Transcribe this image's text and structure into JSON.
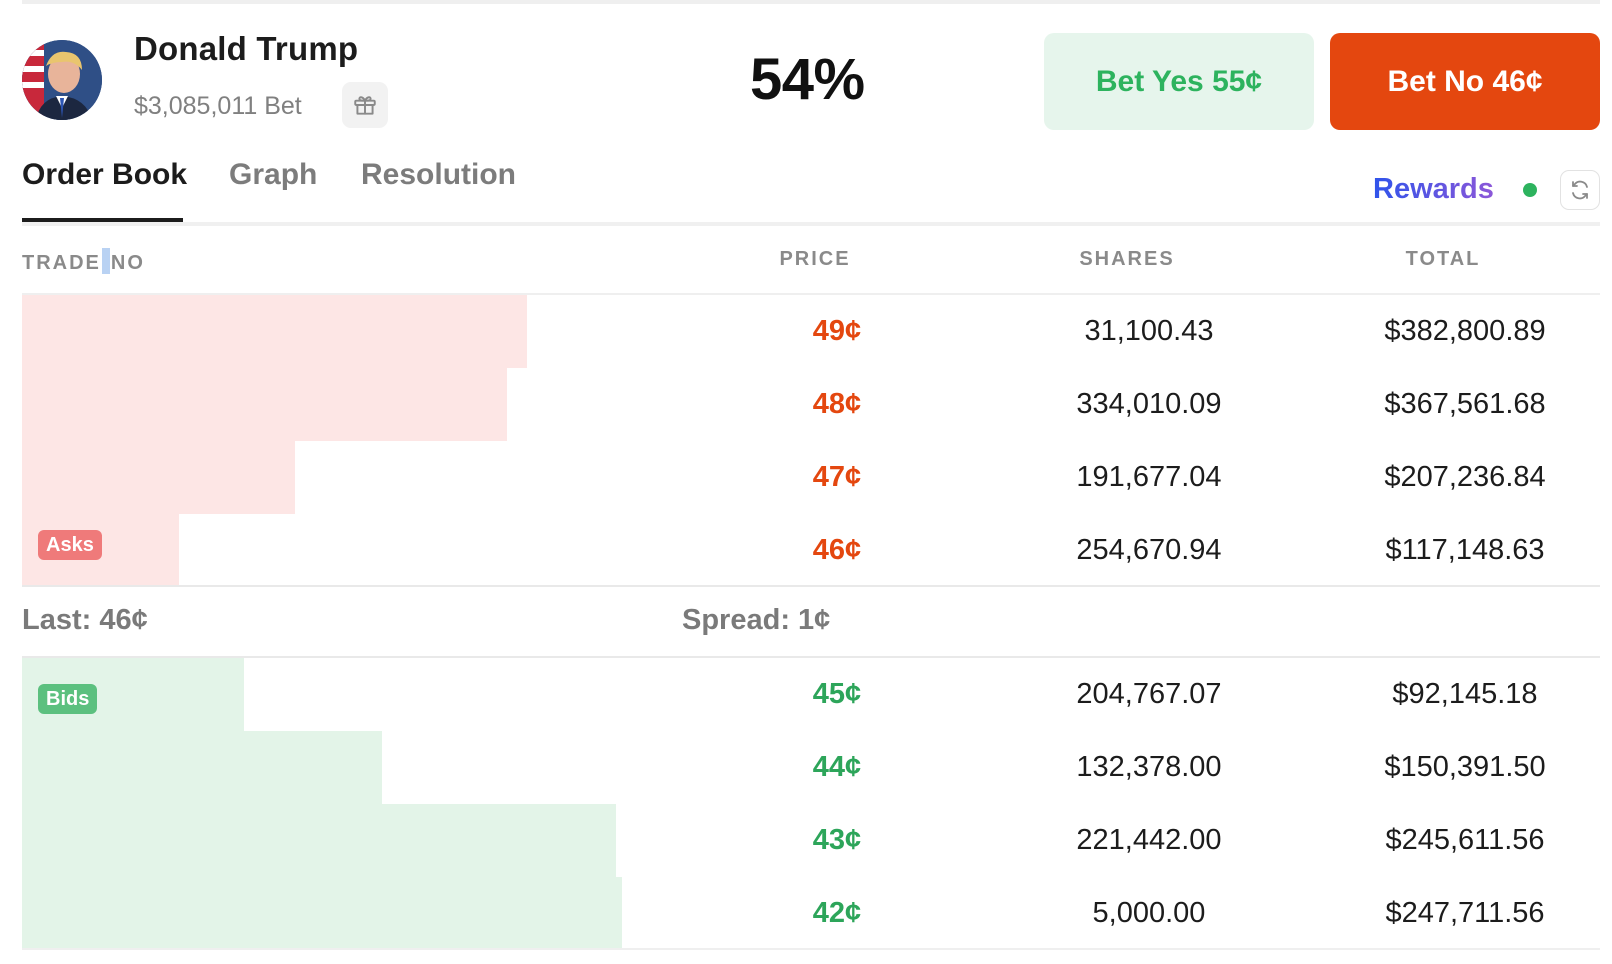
{
  "market": {
    "name": "Donald Trump",
    "volume": "$3,085,011 Bet",
    "probability": "54%"
  },
  "actions": {
    "bet_yes": "Bet Yes 55¢",
    "bet_no": "Bet No 46¢"
  },
  "tabs": [
    {
      "label": "Order Book",
      "active": true
    },
    {
      "label": "Graph",
      "active": false
    },
    {
      "label": "Resolution",
      "active": false
    }
  ],
  "rewards_label": "Rewards",
  "table": {
    "headers": {
      "trade_a": "TRADE",
      "trade_b": "NO",
      "price": "PRICE",
      "shares": "SHARES",
      "total": "TOTAL"
    },
    "asks_badge": "Asks",
    "bids_badge": "Bids",
    "asks": [
      {
        "price": "49¢",
        "shares": "31,100.43",
        "total": "$382,800.89",
        "depth": 1.0
      },
      {
        "price": "48¢",
        "shares": "334,010.09",
        "total": "$367,561.68",
        "depth": 0.96
      },
      {
        "price": "47¢",
        "shares": "191,677.04",
        "total": "$207,236.84",
        "depth": 0.54
      },
      {
        "price": "46¢",
        "shares": "254,670.94",
        "total": "$117,148.63",
        "depth": 0.31
      }
    ],
    "last": "Last: 46¢",
    "spread": "Spread: 1¢",
    "bids": [
      {
        "price": "45¢",
        "shares": "204,767.07",
        "total": "$92,145.18",
        "depth": 0.37
      },
      {
        "price": "44¢",
        "shares": "132,378.00",
        "total": "$150,391.50",
        "depth": 0.6
      },
      {
        "price": "43¢",
        "shares": "221,442.00",
        "total": "$245,611.56",
        "depth": 0.99
      },
      {
        "price": "42¢",
        "shares": "5,000.00",
        "total": "$247,711.56",
        "depth": 1.0
      }
    ]
  },
  "colors": {
    "ask": "#e4470f",
    "bid": "#2da55a",
    "ask_depth": "#fde6e5",
    "bid_depth": "#e3f4e8",
    "bet_no_bg": "#e4470f",
    "bet_yes_bg": "#e6f5ec"
  },
  "icons": {
    "gift": "gift-icon",
    "refresh": "refresh-icon",
    "live": "live-status-dot"
  }
}
